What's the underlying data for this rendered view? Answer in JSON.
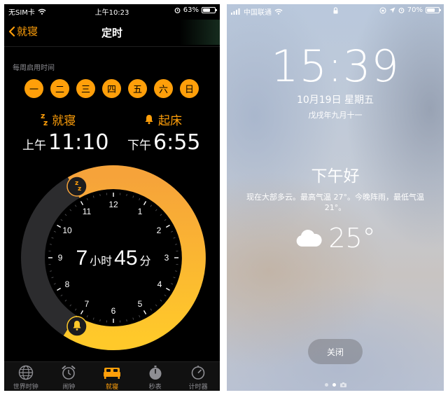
{
  "clock_app": {
    "status_bar": {
      "carrier": "无SIM卡",
      "time": "上午10:23",
      "battery": "63%",
      "battery_level": 0.63
    },
    "nav": {
      "back": "就寝",
      "title": "定时"
    },
    "weekly_label": "每周启用时间",
    "days": [
      "一",
      "二",
      "三",
      "四",
      "五",
      "六",
      "日"
    ],
    "bedtime": {
      "label": "就寝",
      "ampm": "上午",
      "time": "11:10"
    },
    "wake": {
      "label": "起床",
      "ampm": "下午",
      "time": "6:55"
    },
    "duration": {
      "hours": "7",
      "hours_unit": "小时",
      "minutes": "45",
      "minutes_unit": "分"
    },
    "dial_numbers": [
      "12",
      "1",
      "2",
      "3",
      "4",
      "5",
      "6",
      "7",
      "8",
      "9",
      "10",
      "11"
    ],
    "tabs": [
      {
        "label": "世界时钟",
        "icon": "globe-icon"
      },
      {
        "label": "闹钟",
        "icon": "alarm-clock-icon"
      },
      {
        "label": "就寝",
        "icon": "bed-icon",
        "active": true
      },
      {
        "label": "秒表",
        "icon": "stopwatch-icon"
      },
      {
        "label": "计时器",
        "icon": "timer-icon"
      }
    ],
    "accent_color": "#ff9f0a"
  },
  "lock_screen": {
    "status_bar": {
      "carrier": "中国联通",
      "battery": "70%",
      "battery_level": 0.7
    },
    "time": "15:39",
    "date": "10月19日 星期五",
    "lunar": "戊戌年九月十一",
    "greeting": "下午好",
    "forecast": "现在大部多云。最高气温 27°。今晚阵雨，最低气温 21°。",
    "temperature": "25°",
    "weather_icon": "cloud-icon",
    "close_button": "关闭"
  }
}
